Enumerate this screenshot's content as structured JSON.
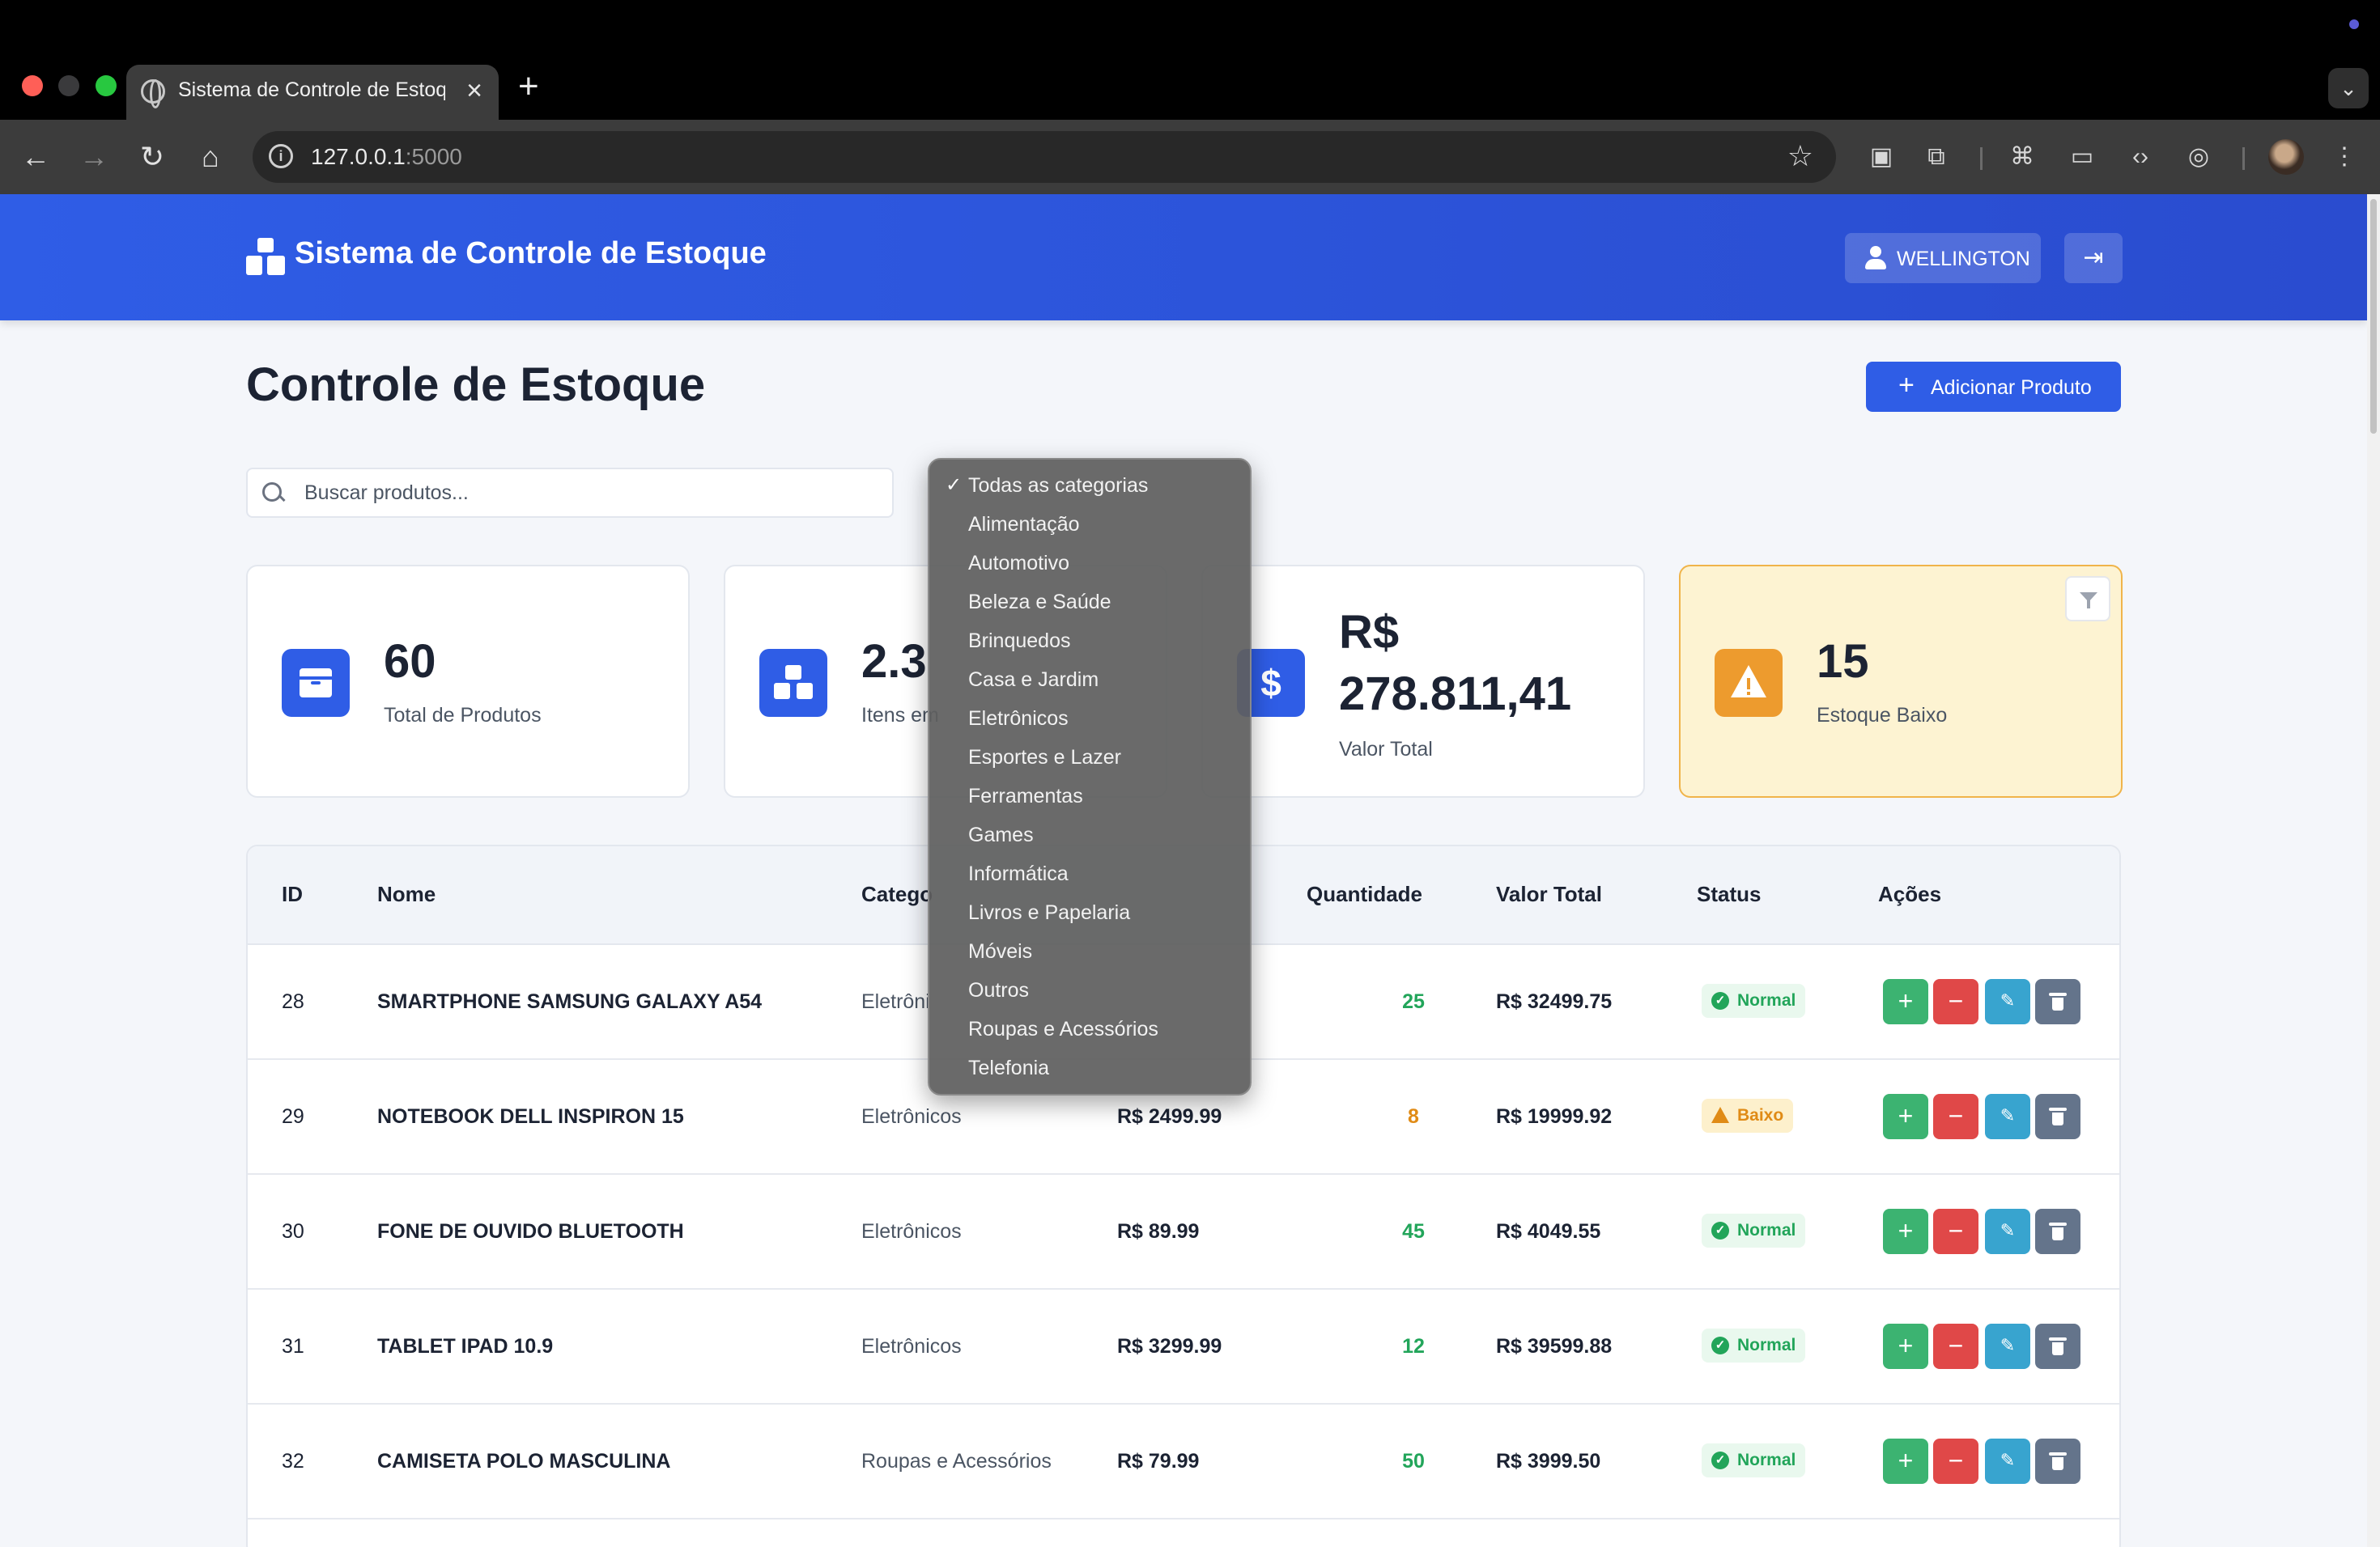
{
  "browser": {
    "tab_title": "Sistema de Controle de Estoque",
    "url_host": "127.0.0.1",
    "url_port": ":5000"
  },
  "app": {
    "brand_title": "Sistema de Controle de Estoque",
    "user_name": "WELLINGTON"
  },
  "page": {
    "title": "Controle de Estoque",
    "add_button": "Adicionar Produto",
    "search_placeholder": "Buscar produtos..."
  },
  "stats": {
    "total_produtos": {
      "value": "60",
      "label": "Total de Produtos"
    },
    "itens_estoque": {
      "value": "2.3",
      "label": "Itens em"
    },
    "valor_total": {
      "value_line1": "R$",
      "value_line2": "278.811,41",
      "label": "Valor Total"
    },
    "estoque_baixo": {
      "value": "15",
      "label": "Estoque Baixo"
    }
  },
  "category_dropdown": {
    "selected": "Todas as categorias",
    "options": [
      "Todas as categorias",
      "Alimentação",
      "Automotivo",
      "Beleza e Saúde",
      "Brinquedos",
      "Casa e Jardim",
      "Eletrônicos",
      "Esportes e Lazer",
      "Ferramentas",
      "Games",
      "Informática",
      "Livros e Papelaria",
      "Móveis",
      "Outros",
      "Roupas e Acessórios",
      "Telefonia"
    ]
  },
  "table": {
    "headers": {
      "id": "ID",
      "nome": "Nome",
      "categoria": "Catego",
      "quantidade": "Quantidade",
      "valor_total": "Valor Total",
      "status": "Status",
      "acoes": "Ações"
    },
    "rows": [
      {
        "id": "28",
        "nome": "SMARTPHONE SAMSUNG GALAXY A54",
        "categoria": "Eletrôni",
        "preco": "",
        "quantidade": "25",
        "valor_total": "R$ 32499.75",
        "status": "Normal"
      },
      {
        "id": "29",
        "nome": "NOTEBOOK DELL INSPIRON 15",
        "categoria": "Eletrônicos",
        "preco": "R$ 2499.99",
        "quantidade": "8",
        "valor_total": "R$ 19999.92",
        "status": "Baixo"
      },
      {
        "id": "30",
        "nome": "FONE DE OUVIDO BLUETOOTH",
        "categoria": "Eletrônicos",
        "preco": "R$ 89.99",
        "quantidade": "45",
        "valor_total": "R$ 4049.55",
        "status": "Normal"
      },
      {
        "id": "31",
        "nome": "TABLET IPAD 10.9",
        "categoria": "Eletrônicos",
        "preco": "R$ 3299.99",
        "quantidade": "12",
        "valor_total": "R$ 39599.88",
        "status": "Normal"
      },
      {
        "id": "32",
        "nome": "CAMISETA POLO MASCULINA",
        "categoria": "Roupas e Acessórios",
        "preco": "R$ 79.99",
        "quantidade": "50",
        "valor_total": "R$ 3999.50",
        "status": "Normal"
      }
    ]
  },
  "colors": {
    "primary": "#2f5de6",
    "success": "#22a55a",
    "warning": "#e08b16",
    "danger": "#e04848",
    "info": "#38a4cf"
  }
}
